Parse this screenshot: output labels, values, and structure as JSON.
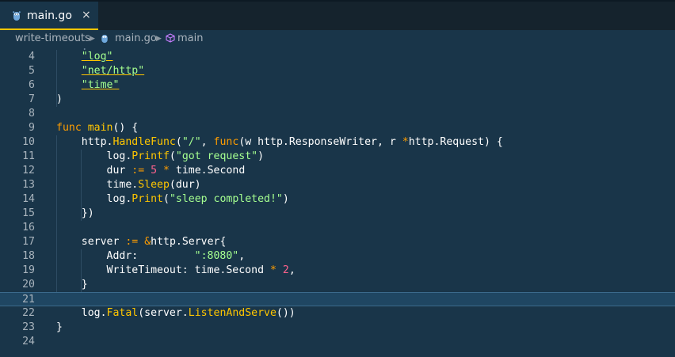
{
  "tab": {
    "filename": "main.go",
    "close_glyph": "×",
    "icon": "go-gopher-icon"
  },
  "breadcrumb": {
    "folder": "write-timeouts",
    "file": "main.go",
    "symbol": "main",
    "separator": "▶"
  },
  "colors": {
    "background": "#193549",
    "tabbar": "#15232d",
    "accent": "#ffc600",
    "keyword": "#ff9d00",
    "string": "#a5ff90",
    "number": "#ff628c",
    "current_line": "#1f4662"
  },
  "editor": {
    "current_line": 21,
    "lines": [
      {
        "n": "4",
        "tokens": [
          {
            "t": "    "
          },
          {
            "t": "\"log\"",
            "c": "imp"
          }
        ]
      },
      {
        "n": "5",
        "tokens": [
          {
            "t": "    "
          },
          {
            "t": "\"net/http\"",
            "c": "imp"
          }
        ]
      },
      {
        "n": "6",
        "tokens": [
          {
            "t": "    "
          },
          {
            "t": "\"time\"",
            "c": "imp"
          }
        ]
      },
      {
        "n": "7",
        "tokens": [
          {
            "t": ")"
          }
        ]
      },
      {
        "n": "8",
        "tokens": []
      },
      {
        "n": "9",
        "tokens": [
          {
            "t": "func",
            "c": "kw"
          },
          {
            "t": " "
          },
          {
            "t": "main",
            "c": "fn"
          },
          {
            "t": "() {"
          }
        ]
      },
      {
        "n": "10",
        "tokens": [
          {
            "t": "    http."
          },
          {
            "t": "HandleFunc",
            "c": "fn"
          },
          {
            "t": "("
          },
          {
            "t": "\"/\"",
            "c": "str"
          },
          {
            "t": ", "
          },
          {
            "t": "func",
            "c": "kw"
          },
          {
            "t": "(w http.ResponseWriter, r "
          },
          {
            "t": "*",
            "c": "kw"
          },
          {
            "t": "http.Request) {"
          }
        ]
      },
      {
        "n": "11",
        "tokens": [
          {
            "t": "        log."
          },
          {
            "t": "Printf",
            "c": "fn"
          },
          {
            "t": "("
          },
          {
            "t": "\"got request\"",
            "c": "str"
          },
          {
            "t": ")"
          }
        ]
      },
      {
        "n": "12",
        "tokens": [
          {
            "t": "        dur "
          },
          {
            "t": ":=",
            "c": "kw"
          },
          {
            "t": " "
          },
          {
            "t": "5",
            "c": "num"
          },
          {
            "t": " "
          },
          {
            "t": "*",
            "c": "kw"
          },
          {
            "t": " time.Second"
          }
        ]
      },
      {
        "n": "13",
        "tokens": [
          {
            "t": "        time."
          },
          {
            "t": "Sleep",
            "c": "fn"
          },
          {
            "t": "(dur)"
          }
        ]
      },
      {
        "n": "14",
        "tokens": [
          {
            "t": "        log."
          },
          {
            "t": "Print",
            "c": "fn"
          },
          {
            "t": "("
          },
          {
            "t": "\"sleep completed!\"",
            "c": "str"
          },
          {
            "t": ")"
          }
        ]
      },
      {
        "n": "15",
        "tokens": [
          {
            "t": "    })"
          }
        ]
      },
      {
        "n": "16",
        "tokens": []
      },
      {
        "n": "17",
        "tokens": [
          {
            "t": "    server "
          },
          {
            "t": ":=",
            "c": "kw"
          },
          {
            "t": " "
          },
          {
            "t": "&",
            "c": "kw"
          },
          {
            "t": "http.Server{"
          }
        ]
      },
      {
        "n": "18",
        "tokens": [
          {
            "t": "        Addr:         "
          },
          {
            "t": "\":8080\"",
            "c": "str"
          },
          {
            "t": ","
          }
        ]
      },
      {
        "n": "19",
        "tokens": [
          {
            "t": "        WriteTimeout: time.Second "
          },
          {
            "t": "*",
            "c": "kw"
          },
          {
            "t": " "
          },
          {
            "t": "2",
            "c": "num"
          },
          {
            "t": ","
          }
        ]
      },
      {
        "n": "20",
        "tokens": [
          {
            "t": "    }"
          }
        ]
      },
      {
        "n": "21",
        "tokens": []
      },
      {
        "n": "22",
        "tokens": [
          {
            "t": "    log."
          },
          {
            "t": "Fatal",
            "c": "fn"
          },
          {
            "t": "(server."
          },
          {
            "t": "ListenAndServe",
            "c": "fn"
          },
          {
            "t": "())"
          }
        ]
      },
      {
        "n": "23",
        "tokens": [
          {
            "t": "}"
          }
        ]
      },
      {
        "n": "24",
        "tokens": []
      }
    ]
  }
}
